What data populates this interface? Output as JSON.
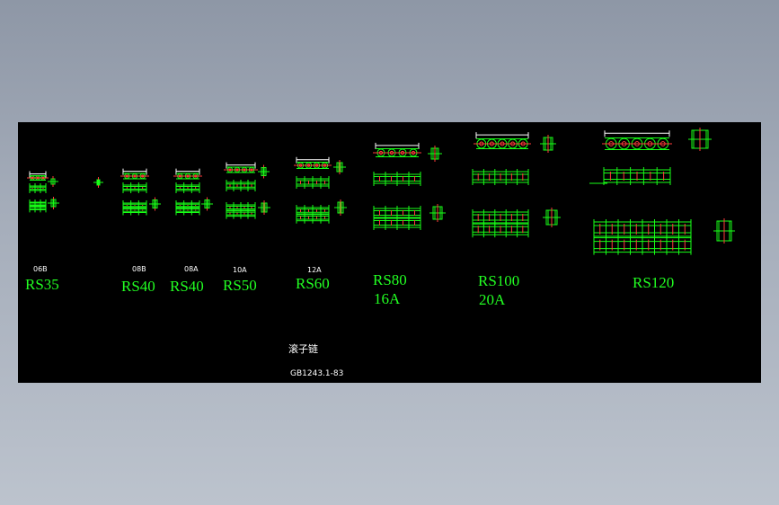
{
  "colors": {
    "background_top": "#8e97a6",
    "background_bottom": "#bcc3cd",
    "canvas": "#000000",
    "line": "#17ff17",
    "accent": "#ff3a3a",
    "text_white": "#ffffff"
  },
  "chains": [
    {
      "code": "06B",
      "name": "RS35",
      "name2": ""
    },
    {
      "code": "08B",
      "name": "RS40",
      "name2": ""
    },
    {
      "code": "08A",
      "name": "RS40",
      "name2": ""
    },
    {
      "code": "10A",
      "name": "RS50",
      "name2": ""
    },
    {
      "code": "12A",
      "name": "RS60",
      "name2": ""
    },
    {
      "code": "",
      "name": "RS80",
      "name2": "16A"
    },
    {
      "code": "",
      "name": "RS100",
      "name2": "20A"
    },
    {
      "code": "",
      "name": "RS120",
      "name2": ""
    }
  ],
  "title": "滚子链",
  "standard": "GB1243.1-83"
}
